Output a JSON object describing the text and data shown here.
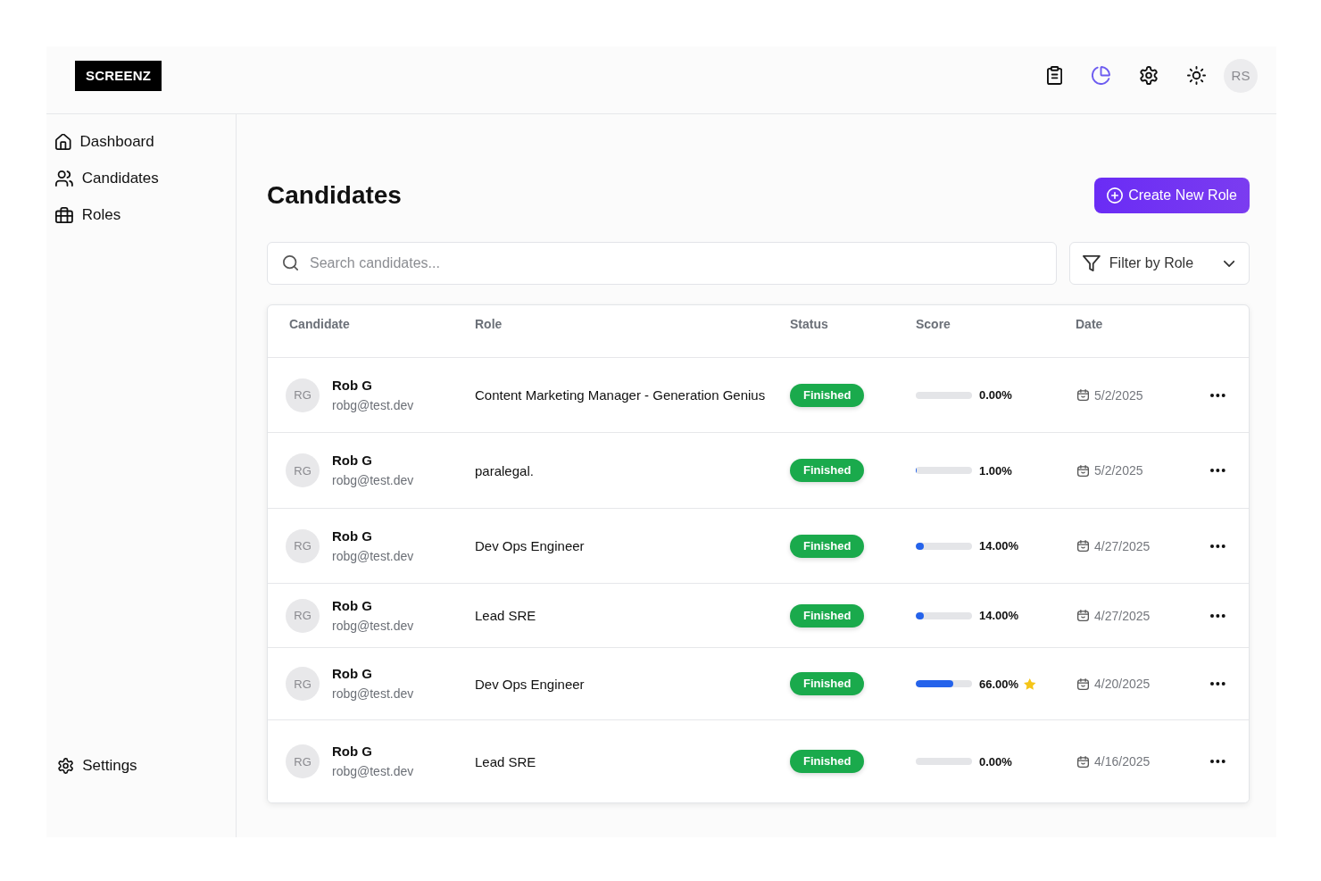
{
  "header": {
    "logo": "SCREENZ",
    "toolbar": [
      {
        "kind": "clipboard",
        "selected": false
      },
      {
        "kind": "pie-chart",
        "selected": true
      },
      {
        "kind": "gear",
        "selected": false
      },
      {
        "kind": "sun",
        "selected": false
      }
    ],
    "avatar": "RS"
  },
  "sidebar": {
    "items": [
      {
        "kind": "home",
        "label": "Dashboard"
      },
      {
        "kind": "users",
        "label": "Candidates"
      },
      {
        "kind": "briefcase",
        "label": "Roles"
      }
    ],
    "footer": {
      "kind": "gear",
      "label": "Settings"
    }
  },
  "main": {
    "title": "Candidates",
    "create_button": "Create New Role",
    "search": {
      "placeholder": "Search candidates..."
    },
    "filter": {
      "label": "Filter by Role"
    },
    "table": {
      "columns": [
        "Candidate",
        "Role",
        "Status",
        "Score",
        "Date"
      ],
      "rows": [
        {
          "initials": "RG",
          "name": "Rob G",
          "email": "robg@test.dev",
          "role": "Content Marketing Manager - Generation Genius",
          "status": "Finished",
          "level": 0,
          "score": "0.00%",
          "starred": false,
          "date": "5/2/2025"
        },
        {
          "initials": "RG",
          "name": "Rob G",
          "email": "robg@test.dev",
          "role": "paralegal.",
          "status": "Finished",
          "level": 0.01,
          "score": "1.00%",
          "starred": false,
          "date": "5/2/2025"
        },
        {
          "initials": "RG",
          "name": "Rob G",
          "email": "robg@test.dev",
          "role": "Dev Ops Engineer",
          "status": "Finished",
          "level": 0.14,
          "score": "14.00%",
          "starred": false,
          "date": "4/27/2025"
        },
        {
          "initials": "RG",
          "name": "Rob G",
          "email": "robg@test.dev",
          "role": "Lead SRE",
          "status": "Finished",
          "level": 0.14,
          "score": "14.00%",
          "starred": false,
          "date": "4/27/2025"
        },
        {
          "initials": "RG",
          "name": "Rob G",
          "email": "robg@test.dev",
          "role": "Dev Ops Engineer",
          "status": "Finished",
          "level": 0.66,
          "score": "66.00%",
          "starred": true,
          "date": "4/20/2025"
        },
        {
          "initials": "RG",
          "name": "Rob G",
          "email": "robg@test.dev",
          "role": "Lead SRE",
          "status": "Finished",
          "level": 0,
          "score": "0.00%",
          "starred": false,
          "date": "4/16/2025"
        }
      ]
    }
  }
}
